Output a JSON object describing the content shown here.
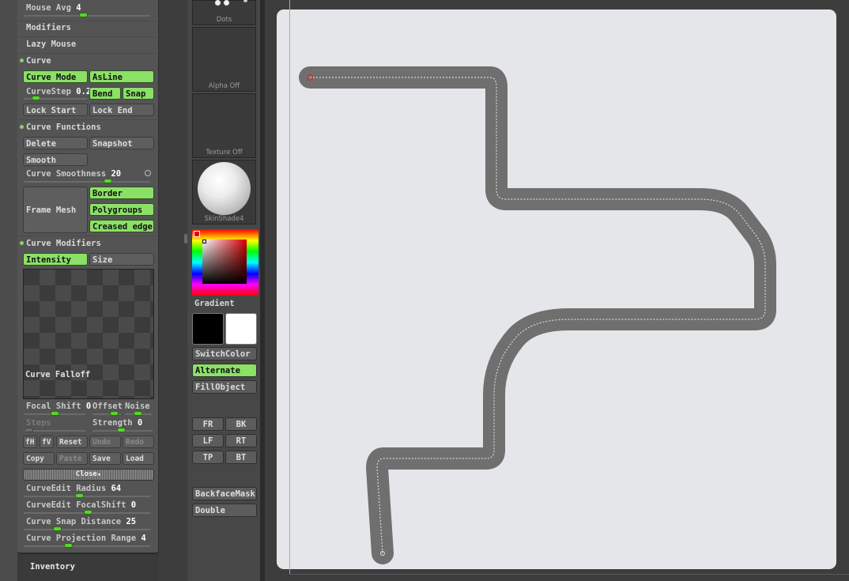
{
  "left_panel": {
    "mouse_avg": {
      "label": "Mouse Avg",
      "value": "4"
    },
    "modifiers_label": "Modifiers",
    "lazy_mouse_label": "Lazy Mouse",
    "curve_header": "Curve",
    "curve_mode_label": "Curve Mode",
    "asline_label": "AsLine",
    "curvestep": {
      "label": "CurveStep",
      "value": "0.2"
    },
    "bend_label": "Bend",
    "snap_label": "Snap",
    "lock_start_label": "Lock Start",
    "lock_end_label": "Lock End",
    "curve_functions_header": "Curve Functions",
    "delete_label": "Delete",
    "snapshot_label": "Snapshot",
    "smooth_label": "Smooth",
    "curve_smoothness": {
      "label": "Curve Smoothness",
      "value": "20"
    },
    "frame_mesh_label": "Frame Mesh",
    "border_label": "Border",
    "polygroups_label": "Polygroups",
    "creased_edges_label": "Creased edge",
    "curve_modifiers_header": "Curve Modifiers",
    "intensity_label": "Intensity",
    "size_label": "Size",
    "curve_falloff_label": "Curve Falloff",
    "focal_shift": {
      "label": "Focal Shift",
      "value": "0"
    },
    "offset_label": "Offset",
    "noise_label": "Noise",
    "steps_label": "Steps",
    "strength": {
      "label": "Strength",
      "value": "0"
    },
    "fh_label": "fH",
    "fv_label": "fV",
    "reset_label": "Reset",
    "undo_label": "Undo",
    "redo_label": "Redo",
    "copy_label": "Copy",
    "paste_label": "Paste",
    "save_label": "Save",
    "load_label": "Load",
    "close_label": "Close",
    "curveedit_radius": {
      "label": "CurveEdit Radius",
      "value": "64"
    },
    "curveedit_focalshift": {
      "label": "CurveEdit FocalShift",
      "value": "0"
    },
    "curve_snap_distance": {
      "label": "Curve Snap Distance",
      "value": "25"
    },
    "curve_projection_range": {
      "label": "Curve Projection Range",
      "value": "4"
    }
  },
  "inventory_label": "Inventory",
  "middle": {
    "dots_label": "Dots",
    "alpha_label": "Alpha Off",
    "texture_label": "Texture Off",
    "material_label": "SkinShade4",
    "gradient_label": "Gradient",
    "switchcolor_label": "SwitchColor",
    "alternate_label": "Alternate",
    "fillobject_label": "FillObject",
    "fr_label": "FR",
    "bk_label": "BK",
    "lf_label": "LF",
    "rt_label": "RT",
    "tp_label": "TP",
    "bt_label": "BT",
    "backfacemask_label": "BackfaceMask",
    "double_label": "Double"
  },
  "colors": {
    "active_green": "#8be066",
    "slider_knob": "#5bd42f",
    "canvas_bg": "#e5e6e9",
    "stroke": "#6e6e6e",
    "main_color": "#000000",
    "secondary_color": "#ffffff"
  }
}
